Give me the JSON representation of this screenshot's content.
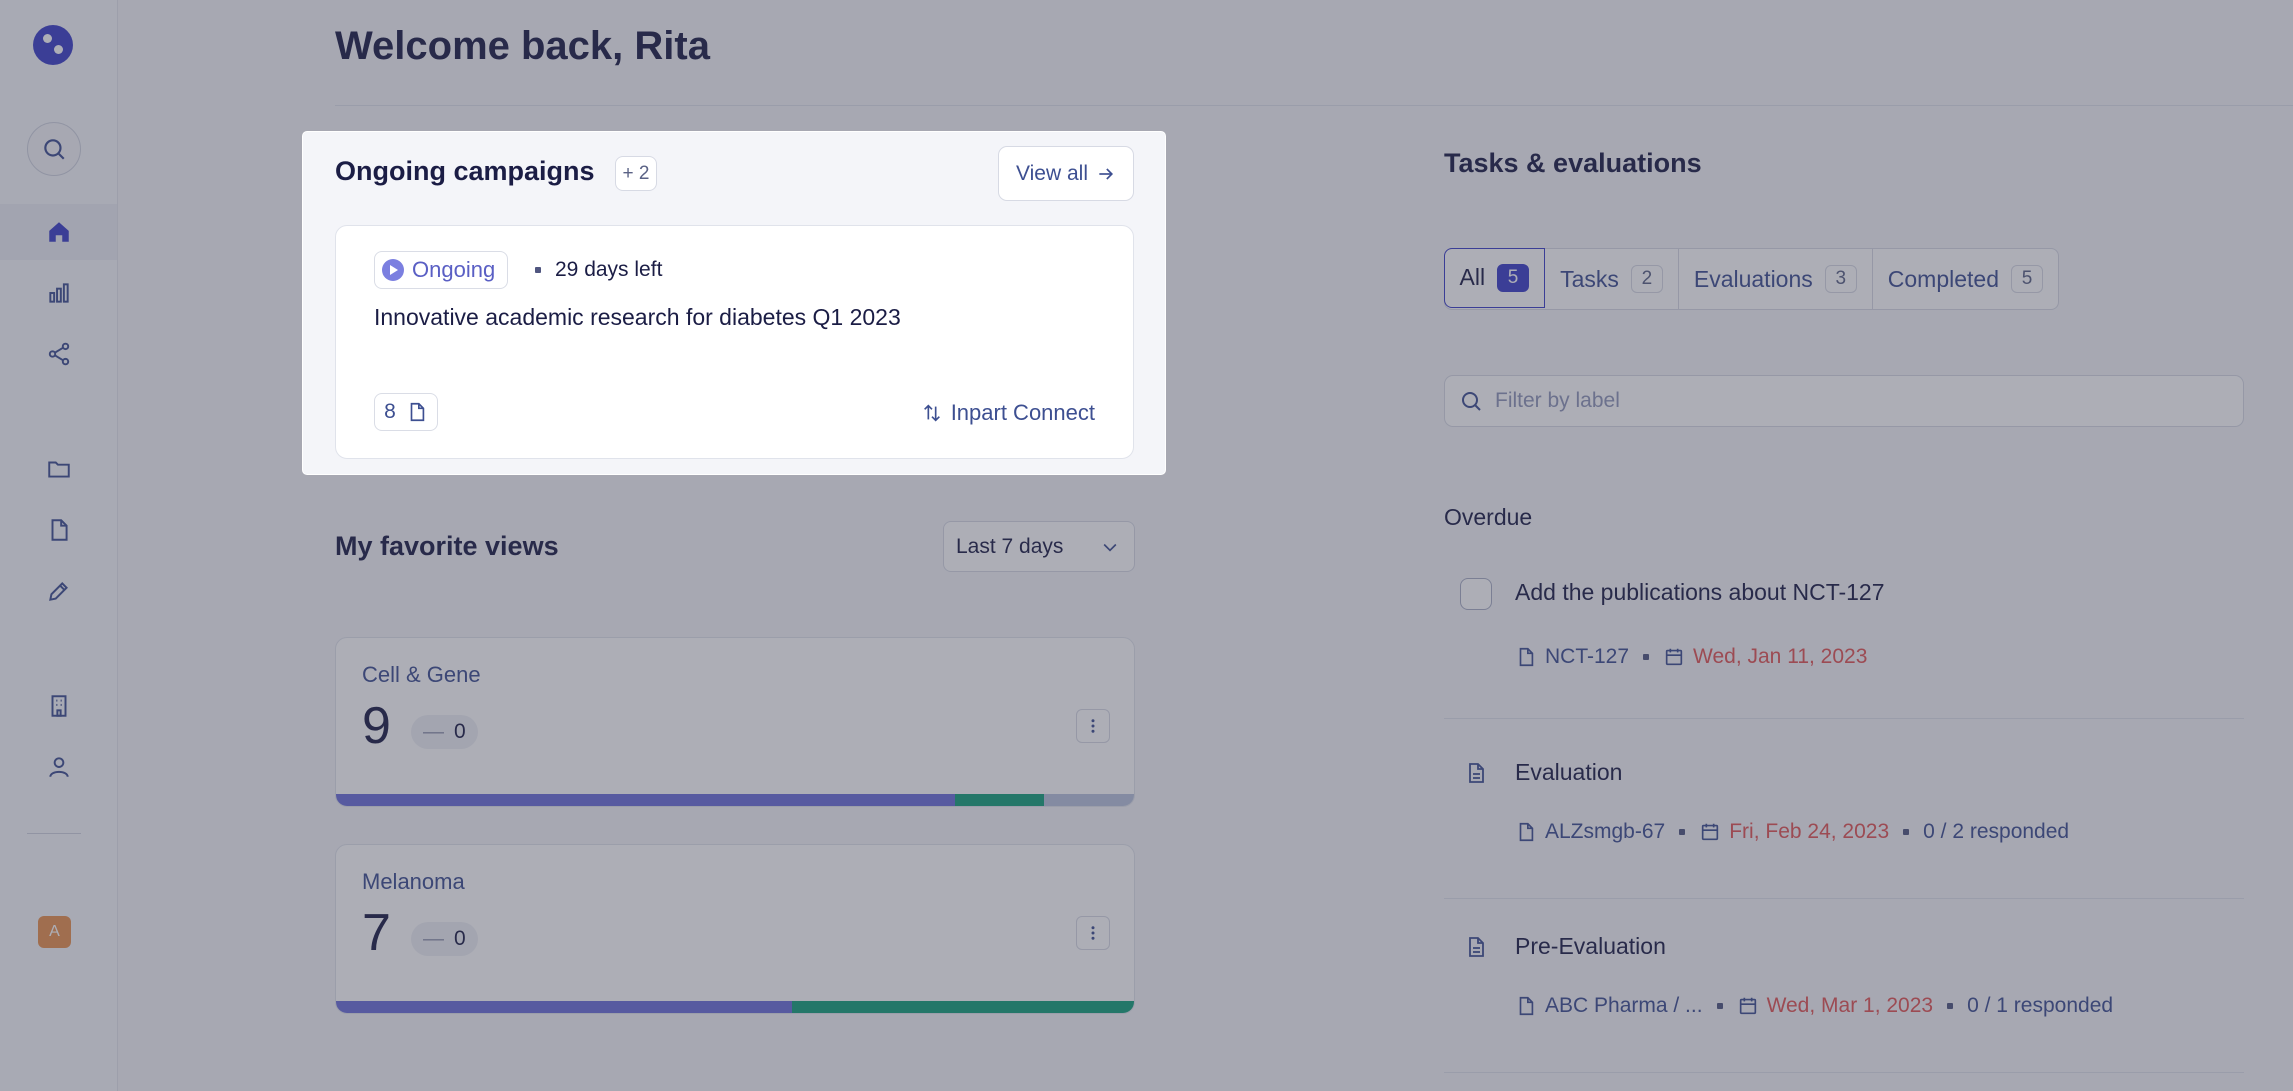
{
  "header": {
    "title": "Welcome back, Rita"
  },
  "sidebar": {
    "avatar_initial": "A",
    "items": [
      {
        "name": "home",
        "active": true
      },
      {
        "name": "analytics",
        "active": false
      },
      {
        "name": "share",
        "active": false
      },
      {
        "name": "folder",
        "active": false
      },
      {
        "name": "document",
        "active": false
      },
      {
        "name": "edit",
        "active": false
      },
      {
        "name": "building",
        "active": false
      },
      {
        "name": "user",
        "active": false
      }
    ]
  },
  "campaigns": {
    "title": "Ongoing campaigns",
    "extra_count": "+ 2",
    "view_all_label": "View all",
    "card": {
      "status": "Ongoing",
      "days_left": "29 days left",
      "title": "Innovative academic research for diabetes Q1 2023",
      "document_count": "8",
      "connect_label": "Inpart Connect"
    }
  },
  "favorites": {
    "title": "My favorite views",
    "range_selected": "Last 7 days",
    "views": [
      {
        "name": "Cell & Gene",
        "count": "9",
        "delta": "0",
        "bar": [
          0.776,
          0.111,
          0.113
        ]
      },
      {
        "name": "Melanoma",
        "count": "7",
        "delta": "0",
        "bar": [
          0.571,
          0.429,
          0
        ]
      }
    ]
  },
  "tasks": {
    "title": "Tasks & evaluations",
    "tabs": [
      {
        "label": "All",
        "count": "5",
        "active": true
      },
      {
        "label": "Tasks",
        "count": "2",
        "active": false
      },
      {
        "label": "Evaluations",
        "count": "3",
        "active": false
      },
      {
        "label": "Completed",
        "count": "5",
        "active": false
      }
    ],
    "filter_placeholder": "Filter by label",
    "group_label": "Overdue",
    "items": [
      {
        "kind": "task",
        "title": "Add the publications about NCT-127",
        "ref": "NCT-127",
        "date": "Wed, Jan 11, 2023",
        "responded": ""
      },
      {
        "kind": "evaluation",
        "title": "Evaluation",
        "ref": "ALZsmgb-67",
        "date": "Fri, Feb 24, 2023",
        "responded": "0 / 2 responded"
      },
      {
        "kind": "evaluation",
        "title": "Pre-Evaluation",
        "ref": "ABC Pharma / ...",
        "date": "Wed, Mar 1, 2023",
        "responded": "0 / 1 responded"
      }
    ]
  },
  "colors": {
    "accent": "#3c3fc8",
    "bar_primary": "#6b6fd9",
    "bar_success": "#13a07b",
    "bar_muted": "#b8c3dc",
    "overdue": "#e25555"
  }
}
